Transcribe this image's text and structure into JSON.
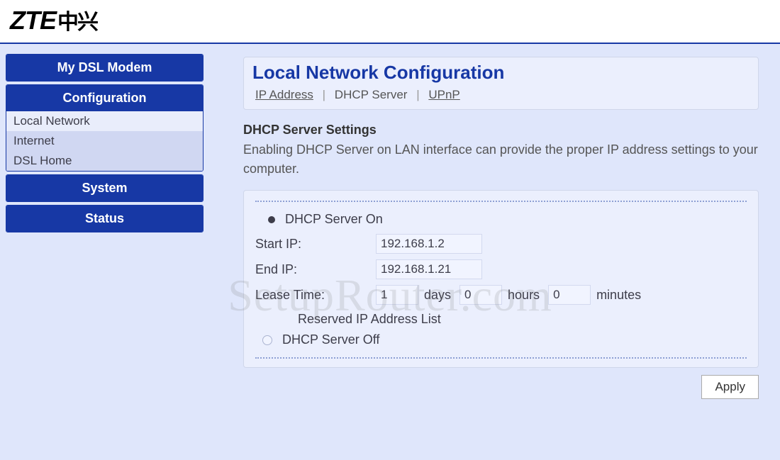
{
  "brand": {
    "en": "ZTE",
    "cn": "中兴"
  },
  "sidebar": {
    "items": [
      {
        "label": "My DSL Modem",
        "type": "header"
      },
      {
        "label": "Configuration",
        "type": "header",
        "expanded": true,
        "children": [
          {
            "label": "Local Network",
            "active": true
          },
          {
            "label": "Internet"
          },
          {
            "label": "DSL Home"
          }
        ]
      },
      {
        "label": "System",
        "type": "header"
      },
      {
        "label": "Status",
        "type": "header"
      }
    ]
  },
  "main": {
    "title": "Local Network Configuration",
    "tabs": [
      {
        "label": "IP Address",
        "current": false
      },
      {
        "label": "DHCP Server",
        "current": true
      },
      {
        "label": "UPnP",
        "current": false
      }
    ],
    "section_title": "DHCP Server Settings",
    "description": "Enabling DHCP Server on LAN interface can provide the proper IP address settings to your computer.",
    "dhcp_on_label": "DHCP Server On",
    "dhcp_off_label": "DHCP Server Off",
    "start_ip_label": "Start IP:",
    "start_ip_value": "192.168.1.2",
    "end_ip_label": "End IP:",
    "end_ip_value": "192.168.1.21",
    "lease_label": "Lease Time:",
    "lease_days": "1",
    "lease_days_unit": "days",
    "lease_hours": "0",
    "lease_hours_unit": "hours",
    "lease_minutes": "0",
    "lease_minutes_unit": "minutes",
    "reserved_link": "Reserved IP Address List",
    "apply_label": "Apply"
  },
  "watermark": "SetupRouter.com"
}
